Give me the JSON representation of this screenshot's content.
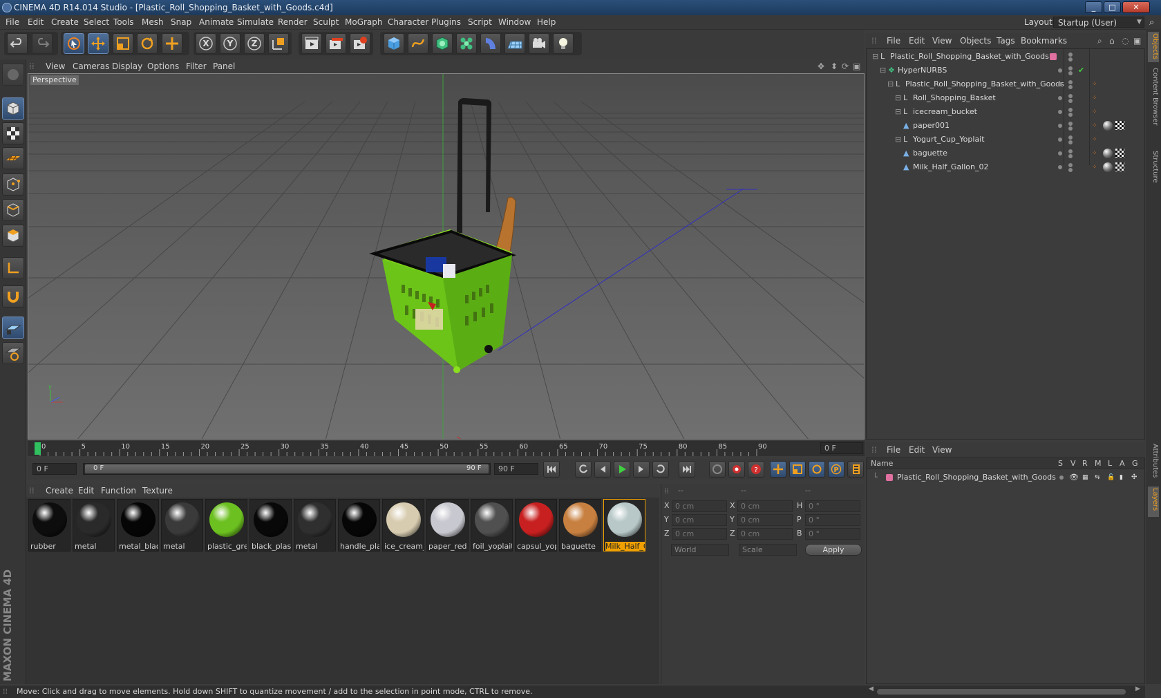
{
  "window": {
    "title": "CINEMA 4D R14.014 Studio - [Plastic_Roll_Shopping_Basket_with_Goods.c4d]",
    "min": "_",
    "max": "□",
    "close": "✕"
  },
  "menubar": [
    "File",
    "Edit",
    "Create",
    "Select",
    "Tools",
    "Mesh",
    "Snap",
    "Animate",
    "Simulate",
    "Render",
    "Sculpt",
    "MoGraph",
    "Character",
    "Plugins",
    "Script",
    "Window",
    "Help"
  ],
  "layout": {
    "label": "Layout:",
    "value": "Startup (User)"
  },
  "toolbar_icons": [
    "undo-icon",
    "redo-icon",
    "live-selection-icon",
    "move-icon",
    "scale-icon",
    "rotate-icon",
    "add-icon",
    "x-axis-icon",
    "y-axis-icon",
    "z-axis-icon",
    "coordinate-system-icon",
    "render-view-icon",
    "render-picture-viewer-icon",
    "render-settings-icon",
    "cube-primitive-icon",
    "spline-pen-icon",
    "subdivision-surface-icon",
    "cloner-icon",
    "deformer-icon",
    "floor-icon",
    "camera-icon",
    "light-icon"
  ],
  "viewport": {
    "menu": [
      "View",
      "Cameras",
      "Display",
      "Options",
      "Filter",
      "Panel"
    ],
    "label": "Perspective"
  },
  "timeline": {
    "ticks": [
      "0",
      "5",
      "10",
      "15",
      "20",
      "25",
      "30",
      "35",
      "40",
      "45",
      "50",
      "55",
      "60",
      "65",
      "70",
      "75",
      "80",
      "85",
      "90"
    ],
    "current_frame": "0 F",
    "start": "0 F",
    "range_start": "0 F",
    "range_end": "90 F",
    "end": "90 F"
  },
  "material_manager": {
    "menu": [
      "Create",
      "Edit",
      "Function",
      "Texture"
    ],
    "materials": [
      {
        "name": "rubber",
        "color": "#0d0d0d"
      },
      {
        "name": "metal",
        "color": "#2a2a2a"
      },
      {
        "name": "metal_black",
        "color": "#050505"
      },
      {
        "name": "metal",
        "color": "#3a3a3a"
      },
      {
        "name": "plastic_green",
        "color": "#6cc020"
      },
      {
        "name": "black_plastic",
        "color": "#080808"
      },
      {
        "name": "metal",
        "color": "#2f2f2f"
      },
      {
        "name": "handle_plastic",
        "color": "#060606"
      },
      {
        "name": "ice_cream_bucket",
        "color": "#d8ccb0"
      },
      {
        "name": "paper_red",
        "color": "#c8c8d0"
      },
      {
        "name": "foil_yoplait",
        "color": "#505050"
      },
      {
        "name": "capsul_yoplait",
        "color": "#c82020"
      },
      {
        "name": "baguette",
        "color": "#c88040"
      },
      {
        "name": "Milk_Half_Gallon",
        "color": "#b8c8c8"
      }
    ]
  },
  "coordinates": {
    "headers": [
      "--",
      "--",
      "--"
    ],
    "rows": [
      {
        "a": "X",
        "av": "0 cm",
        "b": "X",
        "bv": "0 cm",
        "c": "H",
        "cv": "0 °"
      },
      {
        "a": "Y",
        "av": "0 cm",
        "b": "Y",
        "bv": "0 cm",
        "c": "P",
        "cv": "0 °"
      },
      {
        "a": "Z",
        "av": "0 cm",
        "b": "Z",
        "bv": "0 cm",
        "c": "B",
        "cv": "0 °"
      }
    ],
    "mode": "World",
    "type": "Scale",
    "apply": "Apply"
  },
  "object_manager": {
    "menu": [
      "File",
      "Edit",
      "View",
      "Objects",
      "Tags",
      "Bookmarks"
    ],
    "objects": [
      {
        "name": "Plastic_Roll_Shopping_Basket_with_Goods",
        "depth": 0,
        "kind": "null"
      },
      {
        "name": "HyperNURBS",
        "depth": 1,
        "kind": "nurbs"
      },
      {
        "name": "Plastic_Roll_Shopping_Basket_with_Goods",
        "depth": 2,
        "kind": "null"
      },
      {
        "name": "Roll_Shopping_Basket",
        "depth": 3,
        "kind": "null"
      },
      {
        "name": "icecream_bucket",
        "depth": 3,
        "kind": "null"
      },
      {
        "name": "paper001",
        "depth": 3,
        "kind": "poly"
      },
      {
        "name": "Yogurt_Cup_Yoplait",
        "depth": 3,
        "kind": "null"
      },
      {
        "name": "baguette",
        "depth": 3,
        "kind": "poly"
      },
      {
        "name": "Milk_Half_Gallon_02",
        "depth": 3,
        "kind": "poly"
      }
    ]
  },
  "layer_manager": {
    "menu": [
      "File",
      "Edit",
      "View"
    ],
    "columns": [
      "Name",
      "S",
      "V",
      "R",
      "M",
      "L",
      "A",
      "G"
    ],
    "layers": [
      {
        "name": "Plastic_Roll_Shopping_Basket_with_Goods",
        "color": "#e070a0"
      }
    ]
  },
  "side_tabs": [
    "Objects",
    "Content Browser",
    "Structure",
    "Attributes",
    "Layers"
  ],
  "branding": "MAXON CINEMA 4D",
  "status": "Move: Click and drag to move elements. Hold down SHIFT to quantize movement / add to the selection in point mode, CTRL to remove."
}
